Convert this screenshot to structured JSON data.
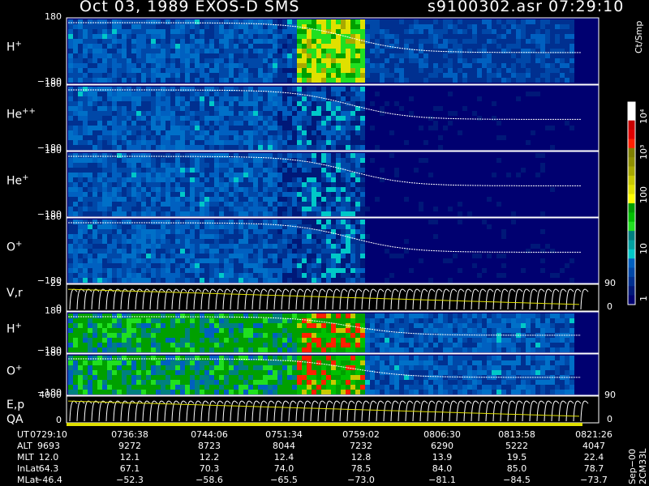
{
  "header": {
    "left": "Oct 03, 1989   EXOS-D SMS",
    "right": "s9100302.asr  07:29:10"
  },
  "panels": [
    {
      "label": "H",
      "sup": "+",
      "tick_top": "180",
      "tick_bot": "−180"
    },
    {
      "label": "He",
      "sup": "++",
      "tick_top": "180",
      "tick_bot": "−180"
    },
    {
      "label": "He",
      "sup": "+",
      "tick_top": "180",
      "tick_bot": "−180"
    },
    {
      "label": "O",
      "sup": "+",
      "tick_top": "180",
      "tick_bot": "−180"
    },
    {
      "label": "V,r",
      "sup": "",
      "tick_top": "25",
      "tick_bot": "0"
    },
    {
      "label": "H",
      "sup": "+",
      "tick_top": "180",
      "tick_bot": "−180"
    },
    {
      "label": "O",
      "sup": "+",
      "tick_top": "180",
      "tick_bot": "−180"
    },
    {
      "label": "E,p",
      "sup": "",
      "tick_top": "4000",
      "tick_bot": "0"
    }
  ],
  "qa_label": "QA",
  "right_ticks": {
    "vr_top": "90",
    "vr_bot": "0",
    "ep_top": "90",
    "ep_bot": "0"
  },
  "colorbar": {
    "unit": "Ct/Smp",
    "ticks": [
      "10⁴",
      "10³",
      "100",
      "10",
      "1"
    ],
    "colors": [
      "#ffffff",
      "#ffffff",
      "#c80000",
      "#e00000",
      "#ff2000",
      "#808000",
      "#909000",
      "#a8a800",
      "#c8c800",
      "#e0e000",
      "#ffff00",
      "#00a000",
      "#00c000",
      "#20e020",
      "#008080",
      "#00a0a0",
      "#00c8c8",
      "#0060c0",
      "#0048a8",
      "#003090",
      "#001878",
      "#000070"
    ]
  },
  "ephemeris": {
    "labels": [
      "UT",
      "ALT",
      "MLT",
      "InLat",
      "MLat"
    ],
    "columns": [
      {
        "UT": "0729:10",
        "ALT": "9693",
        "MLT": "12.0",
        "InLat": "64.3",
        "MLat": "−46.4"
      },
      {
        "UT": "0736:38",
        "ALT": "9272",
        "MLT": "12.1",
        "InLat": "67.1",
        "MLat": "−52.3"
      },
      {
        "UT": "0744:06",
        "ALT": "8723",
        "MLT": "12.2",
        "InLat": "70.3",
        "MLat": "−58.6"
      },
      {
        "UT": "0751:34",
        "ALT": "8044",
        "MLT": "12.4",
        "InLat": "74.0",
        "MLat": "−65.5"
      },
      {
        "UT": "0759:02",
        "ALT": "7232",
        "MLT": "12.8",
        "InLat": "78.5",
        "MLat": "−73.0"
      },
      {
        "UT": "0806:30",
        "ALT": "6290",
        "MLT": "13.9",
        "InLat": "84.0",
        "MLat": "−81.1"
      },
      {
        "UT": "0813:58",
        "ALT": "5222",
        "MLT": "19.5",
        "InLat": "85.0",
        "MLat": "−84.5"
      },
      {
        "UT": "0821:26",
        "ALT": "4047",
        "MLT": "22.4",
        "InLat": "78.7",
        "MLat": "−73.7"
      }
    ]
  },
  "footer": "Sep−00  2CM33L",
  "chart_data": {
    "type": "heatmap",
    "title": "Oct 03, 1989   EXOS-D SMS",
    "x": [
      "0729:10",
      "0736:38",
      "0744:06",
      "0751:34",
      "0759:02",
      "0806:30",
      "0813:58",
      "0821:26"
    ],
    "series": [
      {
        "name": "H+",
        "ylim": [
          -180,
          180
        ]
      },
      {
        "name": "He++",
        "ylim": [
          -180,
          180
        ]
      },
      {
        "name": "He+",
        "ylim": [
          -180,
          180
        ]
      },
      {
        "name": "O+",
        "ylim": [
          -180,
          180
        ]
      },
      {
        "name": "V,r",
        "ylim": [
          0,
          25
        ]
      },
      {
        "name": "H+",
        "ylim": [
          -180,
          180
        ]
      },
      {
        "name": "O+",
        "ylim": [
          -180,
          180
        ]
      },
      {
        "name": "E,p",
        "ylim": [
          0,
          4000
        ]
      }
    ],
    "colorbar_range": [
      1,
      10000
    ],
    "colorbar_scale": "log"
  }
}
